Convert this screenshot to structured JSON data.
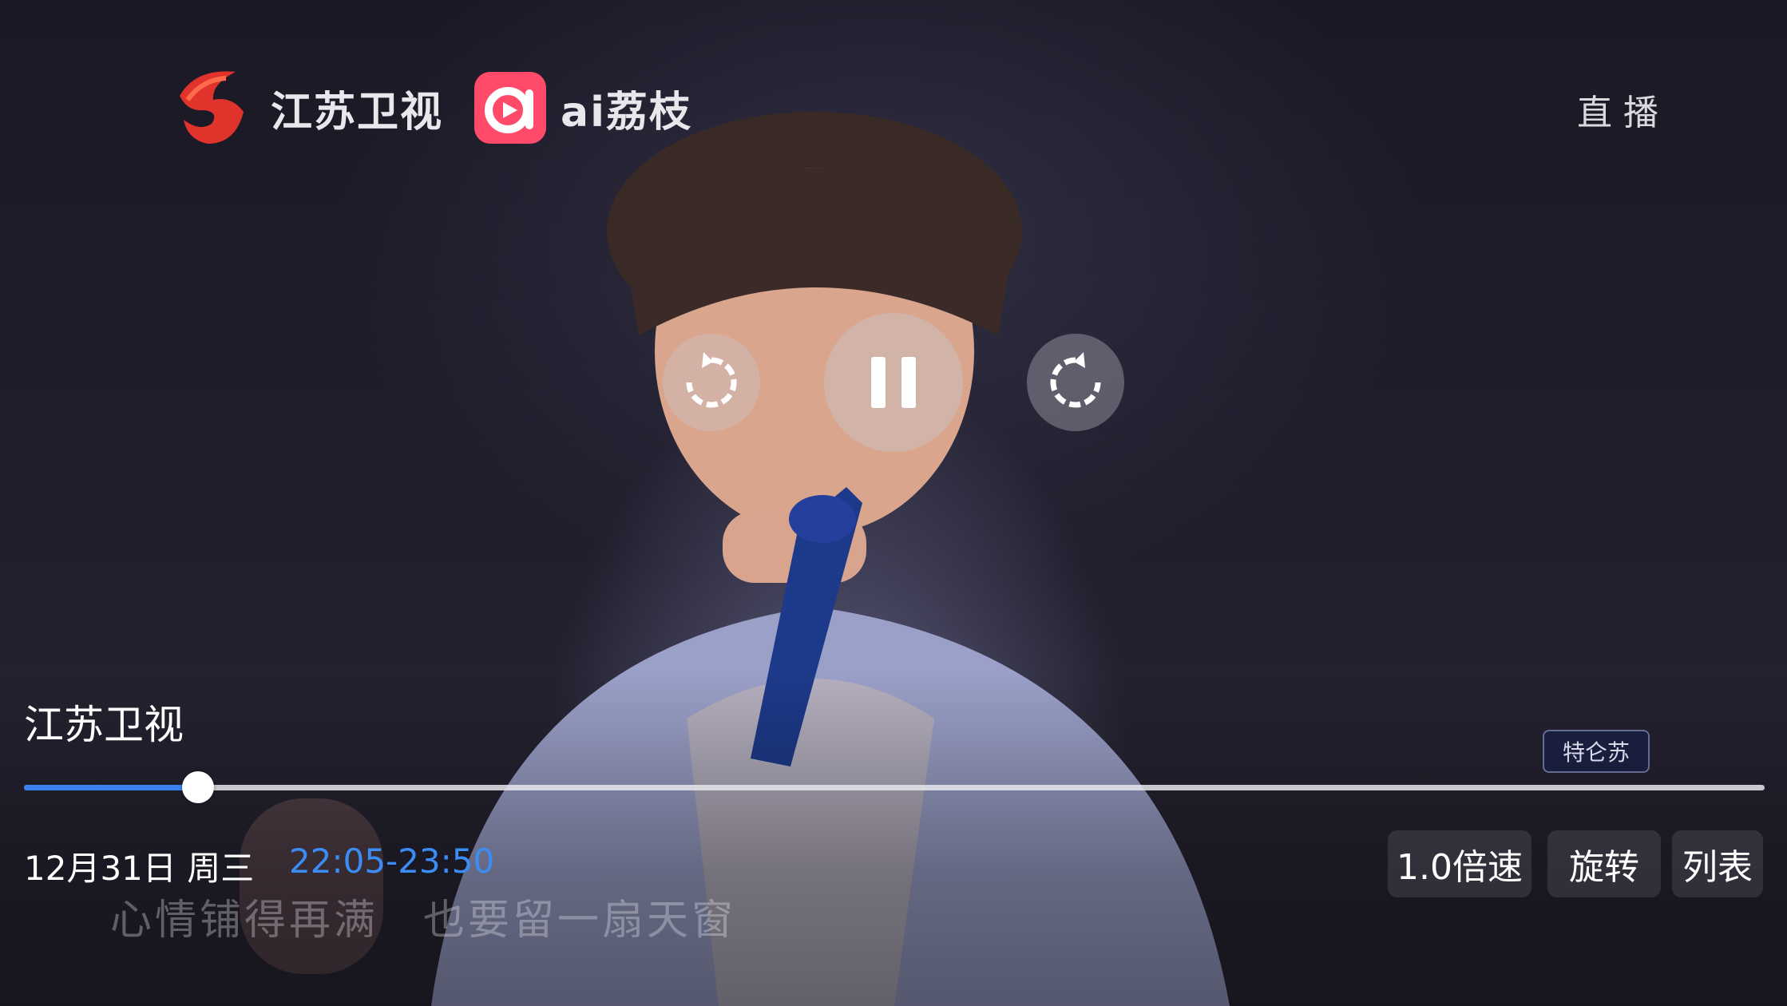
{
  "header": {
    "channel_logo_text": "江苏卫视",
    "app_logo_text": "ai荔枝",
    "live_label": "直播"
  },
  "player": {
    "channel_name": "江苏卫视",
    "date": "12月31日 周三",
    "time_range": "22:05-23:50",
    "progress_fraction": 0.1,
    "subtitle": "心情铺得再满　也要留一扇天窗",
    "buttons": {
      "speed": "1.0倍速",
      "rotate": "旋转",
      "list": "列表"
    },
    "show_badge": "特仑苏"
  },
  "colors": {
    "accent": "#3b8cf5",
    "progress_track": "#e6e6eb"
  },
  "icons": {
    "rewind": "rewind-icon",
    "pause": "pause-icon",
    "forward": "forward-icon"
  }
}
